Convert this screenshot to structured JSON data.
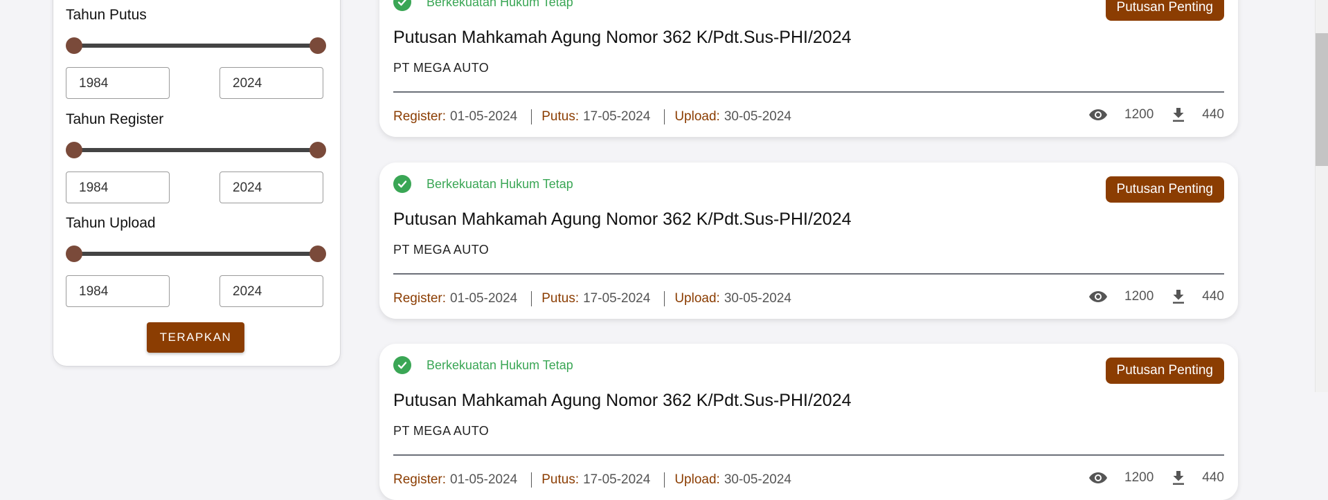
{
  "filters": {
    "groups": [
      {
        "label": "Tahun Putus",
        "min": "1984",
        "max": "2024"
      },
      {
        "label": "Tahun Register",
        "min": "1984",
        "max": "2024"
      },
      {
        "label": "Tahun Upload",
        "min": "1984",
        "max": "2024"
      }
    ],
    "apply_label": "TERAPKAN"
  },
  "cards": [
    {
      "status": "Berkekuatan Hukum Tetap",
      "badge": "Putusan Penting",
      "title": "Putusan Mahkamah Agung Nomor 362 K/Pdt.Sus-PHI/2024",
      "party": "PT MEGA AUTO",
      "register_label": "Register:",
      "register": "01-05-2024",
      "putus_label": "Putus:",
      "putus": "17-05-2024",
      "upload_label": "Upload:",
      "upload": "30-05-2024",
      "views": "1200",
      "downloads": "440"
    },
    {
      "status": "Berkekuatan Hukum Tetap",
      "badge": "Putusan Penting",
      "title": "Putusan Mahkamah Agung Nomor 362 K/Pdt.Sus-PHI/2024",
      "party": "PT MEGA AUTO",
      "register_label": "Register:",
      "register": "01-05-2024",
      "putus_label": "Putus:",
      "putus": "17-05-2024",
      "upload_label": "Upload:",
      "upload": "30-05-2024",
      "views": "1200",
      "downloads": "440"
    },
    {
      "status": "Berkekuatan Hukum Tetap",
      "badge": "Putusan Penting",
      "title": "Putusan Mahkamah Agung Nomor 362 K/Pdt.Sus-PHI/2024",
      "party": "PT MEGA AUTO",
      "register_label": "Register:",
      "register": "01-05-2024",
      "putus_label": "Putus:",
      "putus": "17-05-2024",
      "upload_label": "Upload:",
      "upload": "30-05-2024",
      "views": "1200",
      "downloads": "440"
    }
  ],
  "icons": {
    "status": "check-circle-icon",
    "views": "eye-icon",
    "downloads": "download-icon"
  },
  "colors": {
    "accent": "#8b3d02",
    "status_green": "#3aa655",
    "knob": "#7a4a3a"
  }
}
